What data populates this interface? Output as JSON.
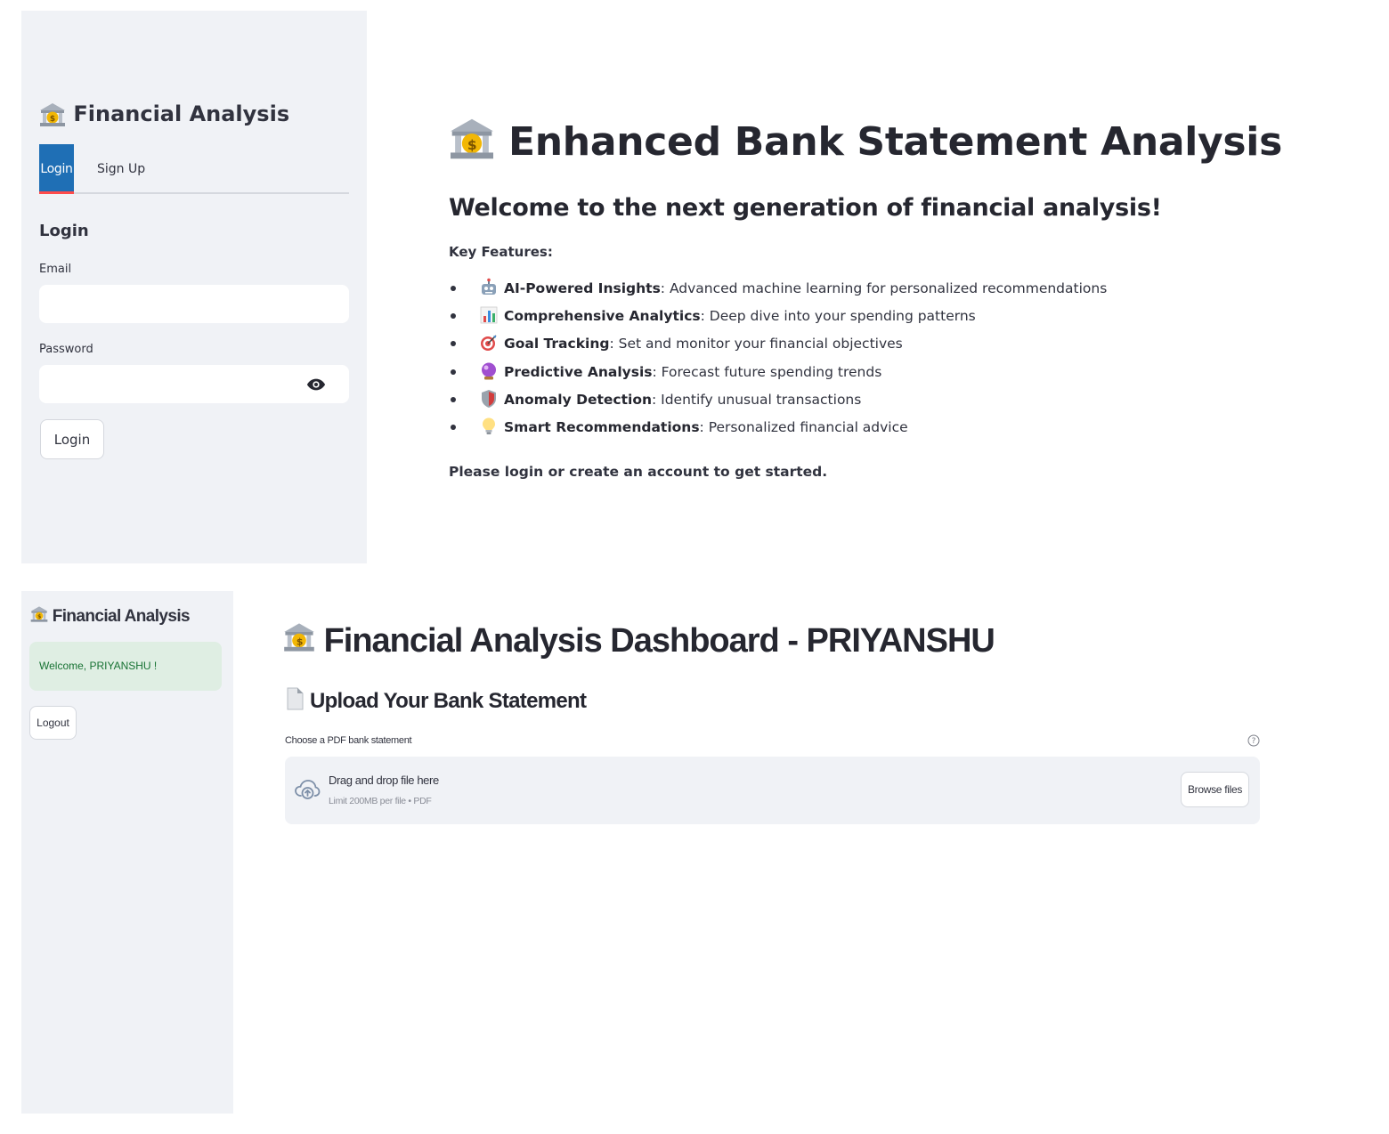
{
  "login_view": {
    "sidebar": {
      "title": "Financial Analysis",
      "tabs": [
        {
          "label": "Login",
          "active": true
        },
        {
          "label": "Sign Up",
          "active": false
        }
      ],
      "form_title": "Login",
      "email_label": "Email",
      "email_value": "",
      "password_label": "Password",
      "password_value": "",
      "login_button": "Login"
    },
    "main": {
      "title": "Enhanced Bank Statement Analysis",
      "subtitle": "Welcome to the next generation of financial analysis!",
      "key_features_label": "Key Features:",
      "features": [
        {
          "icon": "robot-icon",
          "name": "AI-Powered Insights",
          "desc": ": Advanced machine learning for personalized recommendations"
        },
        {
          "icon": "bar-chart-icon",
          "name": "Comprehensive Analytics",
          "desc": ": Deep dive into your spending patterns"
        },
        {
          "icon": "target-icon",
          "name": "Goal Tracking",
          "desc": ": Set and monitor your financial objectives"
        },
        {
          "icon": "crystal-ball-icon",
          "name": "Predictive Analysis",
          "desc": ": Forecast future spending trends"
        },
        {
          "icon": "shield-icon",
          "name": "Anomaly Detection",
          "desc": ": Identify unusual transactions"
        },
        {
          "icon": "lightbulb-icon",
          "name": "Smart Recommendations",
          "desc": ": Personalized financial advice"
        }
      ],
      "cta": "Please login or create an account to get started."
    }
  },
  "dashboard_view": {
    "sidebar": {
      "title": "Financial Analysis",
      "welcome_message": "Welcome, PRIYANSHU !",
      "logout_button": "Logout"
    },
    "main": {
      "title": "Financial Analysis Dashboard - PRIYANSHU",
      "upload_title": "Upload Your Bank Statement",
      "uploader_label": "Choose a PDF bank statement",
      "dropzone_text": "Drag and drop file here",
      "dropzone_limit": "Limit 200MB per file • PDF",
      "browse_button": "Browse files"
    }
  },
  "colors": {
    "sidebar_bg": "#f0f2f6",
    "active_tab_bg": "#1f6fb5",
    "active_tab_underline": "#ff4b4b",
    "success_bg": "#dfeee3",
    "success_text": "#177233",
    "text": "#31333f"
  }
}
